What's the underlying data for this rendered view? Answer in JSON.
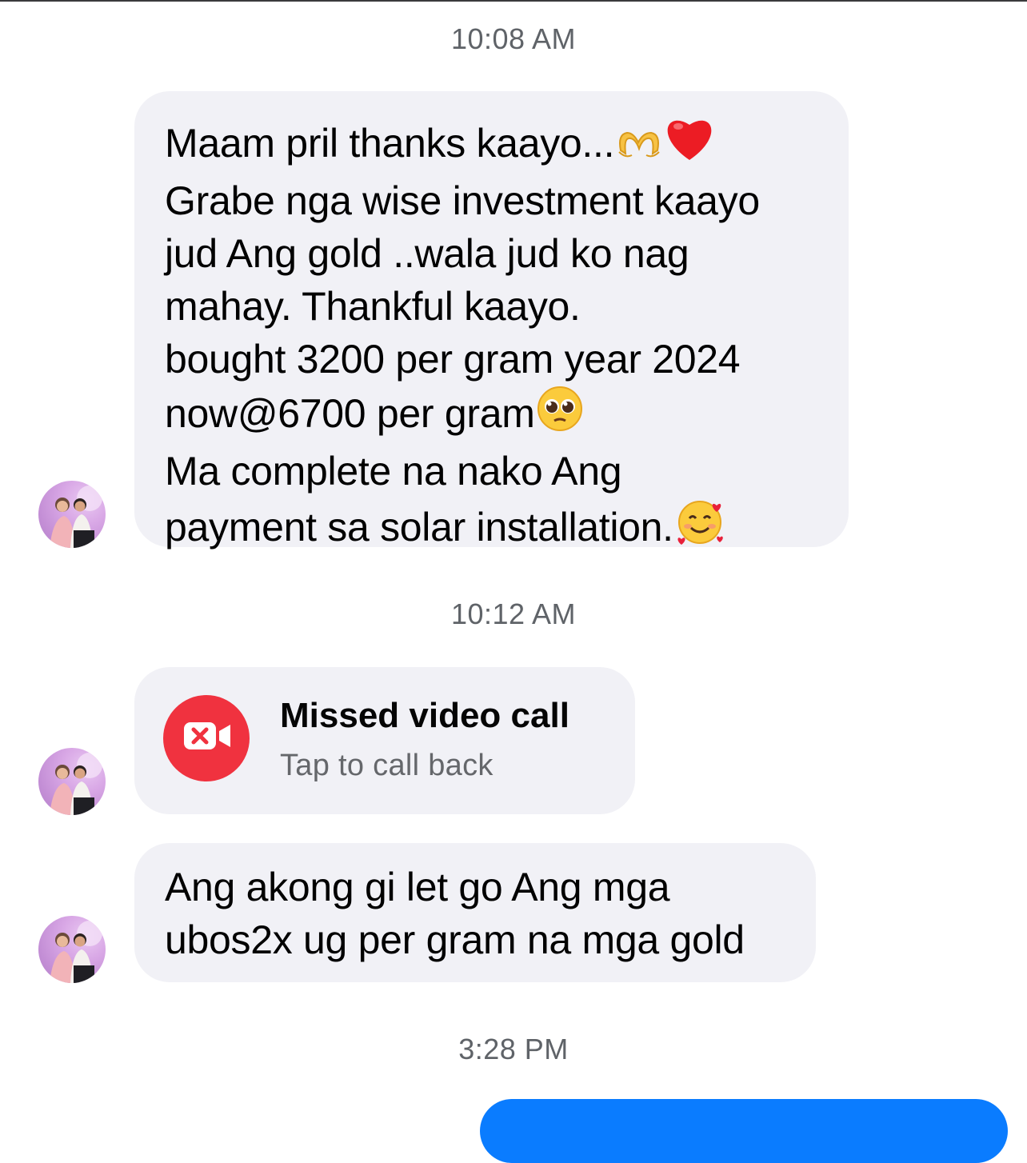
{
  "timestamps": [
    "10:08 AM",
    "10:12 AM",
    "3:28 PM"
  ],
  "messages": {
    "first": {
      "lines": [
        "Maam pril thanks kaayo...",
        "Grabe nga wise investment kaayo",
        "jud Ang gold ..wala jud ko nag",
        "mahay. Thankful kaayo.",
        "bought 3200 per gram year 2024",
        "now@6700 per gram",
        "Ma complete na nako Ang",
        "payment sa solar installation."
      ],
      "emojis": [
        "heart-hands-emoji",
        "red-heart-emoji",
        "pleading-face-emoji",
        "smiling-face-with-hearts-emoji"
      ]
    },
    "missed_call": {
      "title": "Missed video call",
      "subtitle": "Tap to call back",
      "icon": "missed-video-call-icon",
      "icon_color": "#f0323f"
    },
    "third": {
      "lines": [
        "Ang akong gi let go Ang mga",
        "ubos2x ug per gram na mga gold"
      ]
    }
  },
  "colors": {
    "incoming_bubble": "#f1f1f6",
    "outgoing_bubble": "#0a7cff",
    "timestamp_text": "#5f6368",
    "secondary_text": "#65676b"
  }
}
